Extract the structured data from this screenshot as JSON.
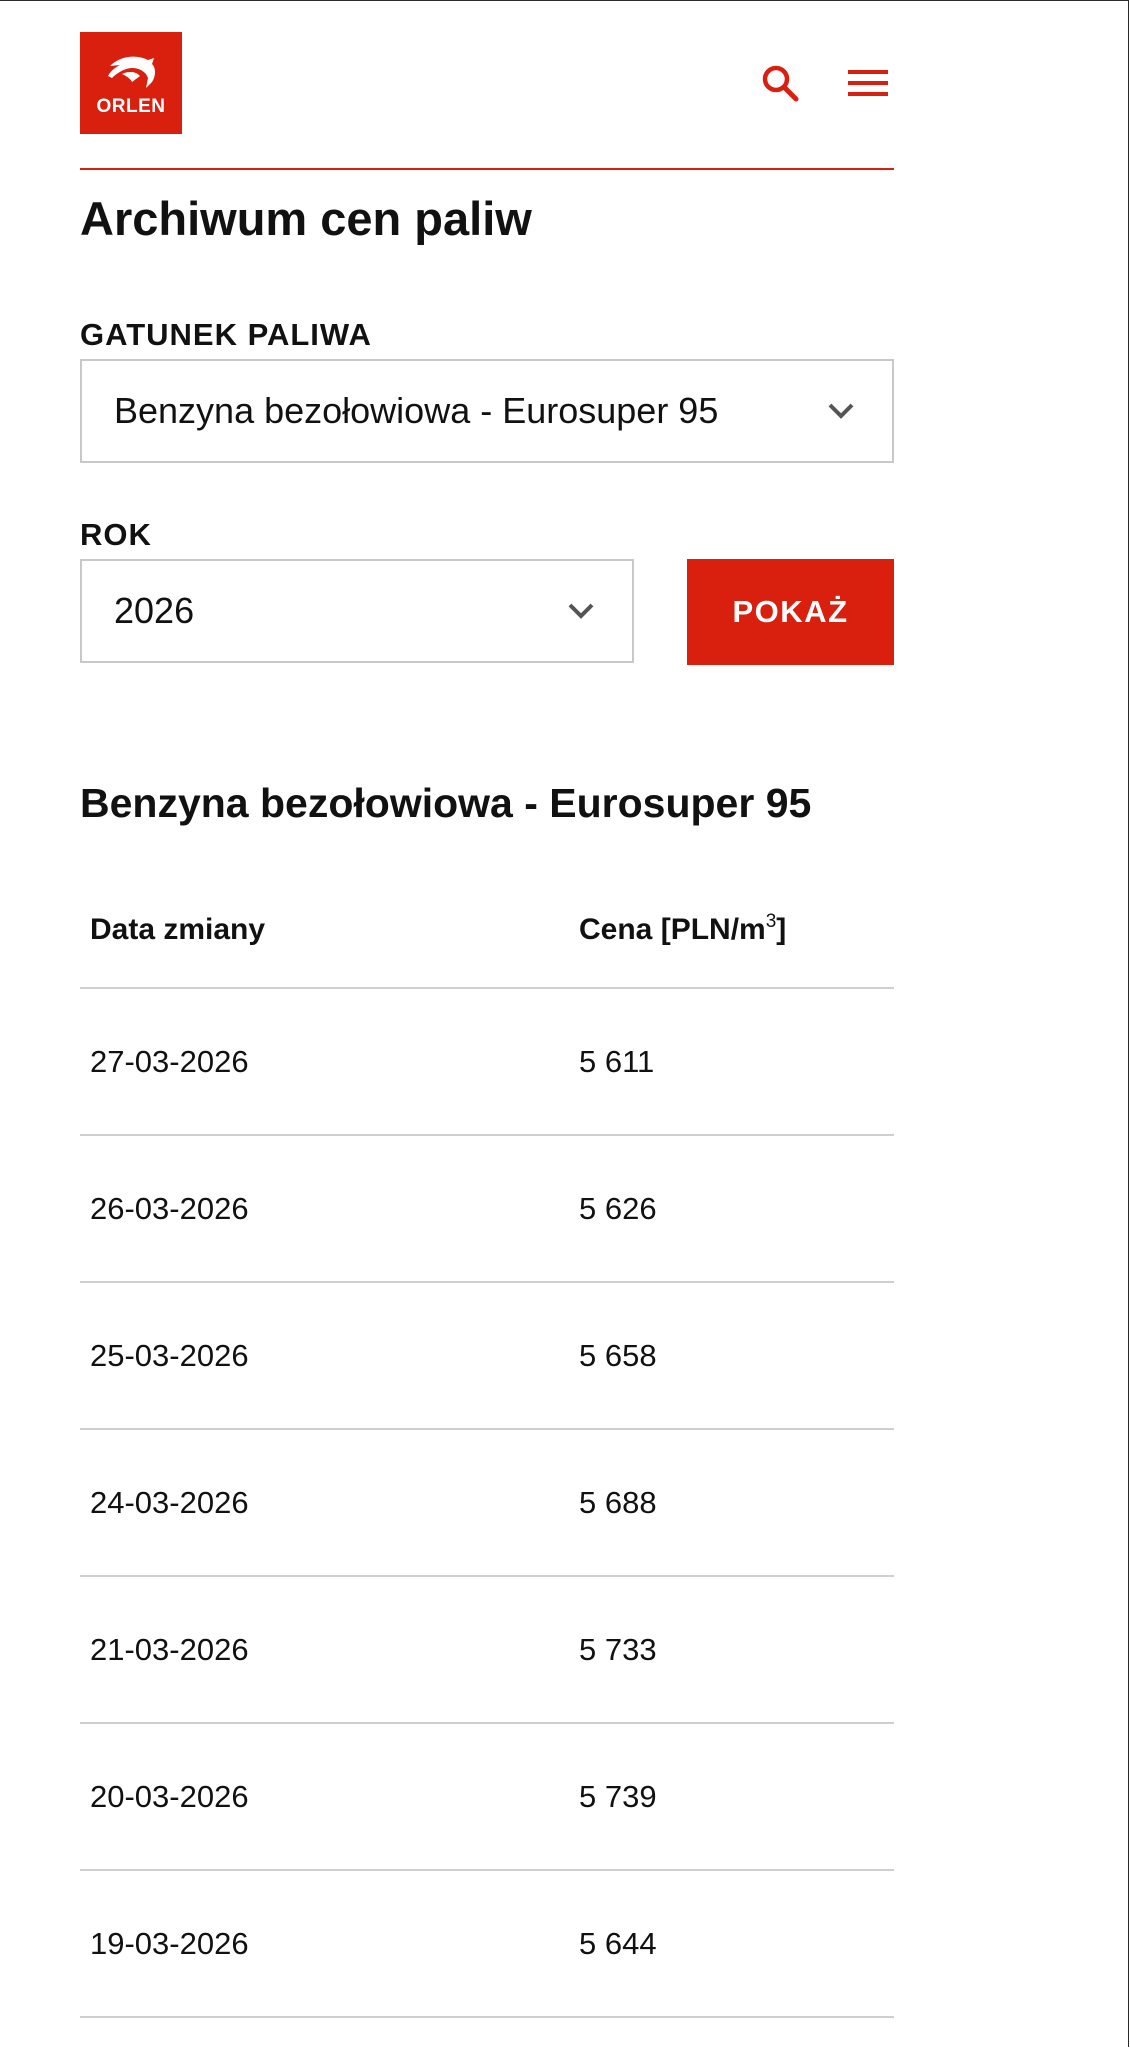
{
  "brand": {
    "logo_text": "ORLEN",
    "color": "#d9200f"
  },
  "header": {
    "search_icon": "search-icon",
    "menu_icon": "hamburger-menu-icon"
  },
  "page": {
    "title": "Archiwum cen paliw"
  },
  "filters": {
    "fuel_label": "GATUNEK PALIWA",
    "fuel_selected": "Benzyna bezołowiowa - Eurosuper 95",
    "year_label": "ROK",
    "year_selected": "2026",
    "show_button": "POKAŻ"
  },
  "results": {
    "title": "Benzyna bezołowiowa - Eurosuper 95",
    "columns": {
      "date": "Data zmiany",
      "price_prefix": "Cena [",
      "price_unit": "PLN/m",
      "price_exp": "3",
      "price_suffix": "]"
    },
    "rows": [
      {
        "date": "27-03-2026",
        "price": "5 611"
      },
      {
        "date": "26-03-2026",
        "price": "5 626"
      },
      {
        "date": "25-03-2026",
        "price": "5 658"
      },
      {
        "date": "24-03-2026",
        "price": "5 688"
      },
      {
        "date": "21-03-2026",
        "price": "5 733"
      },
      {
        "date": "20-03-2026",
        "price": "5 739"
      },
      {
        "date": "19-03-2026",
        "price": "5 644"
      }
    ]
  }
}
